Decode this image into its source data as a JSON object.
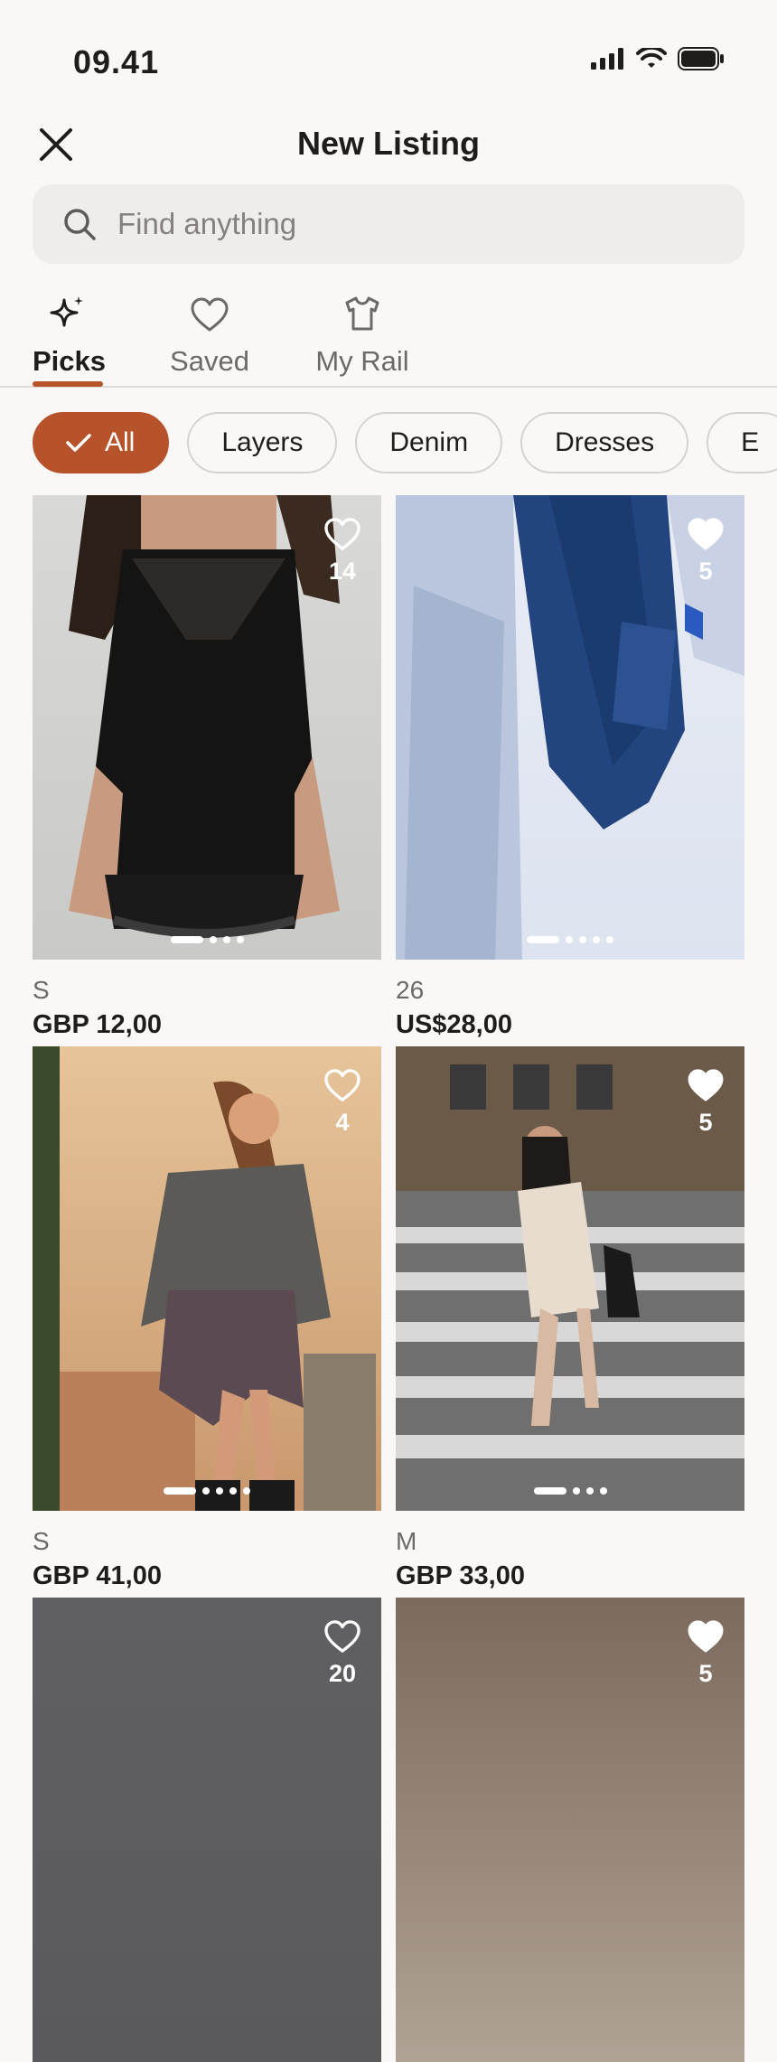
{
  "status": {
    "time": "09.41"
  },
  "header": {
    "title": "New Listing"
  },
  "search": {
    "placeholder": "Find anything"
  },
  "tabs": [
    {
      "label": "Picks",
      "icon": "sparkle-icon",
      "active": true
    },
    {
      "label": "Saved",
      "icon": "heart-icon",
      "active": false
    },
    {
      "label": "My Rail",
      "icon": "tshirt-icon",
      "active": false
    }
  ],
  "chips": [
    "All",
    "Layers",
    "Denim",
    "Dresses",
    "E"
  ],
  "listings": [
    {
      "size": "S",
      "price": "GBP 12,00",
      "likes": "14",
      "liked": false,
      "photos": 4,
      "photo_desc": "black lace slip top"
    },
    {
      "size": "26",
      "price": "US$28,00",
      "likes": "5",
      "liked": true,
      "photos": 5,
      "photo_desc": "denim jeans hanging"
    },
    {
      "size": "S",
      "price": "GBP 41,00",
      "likes": "4",
      "liked": false,
      "photos": 5,
      "photo_desc": "grey sweater with plaid shirt"
    },
    {
      "size": "M",
      "price": "GBP 33,00",
      "likes": "5",
      "liked": true,
      "photos": 4,
      "photo_desc": "cream sweater dress street"
    },
    {
      "size": "",
      "price": "",
      "likes": "20",
      "liked": false,
      "photos": 0,
      "photo_desc": ""
    },
    {
      "size": "",
      "price": "",
      "likes": "5",
      "liked": true,
      "photos": 0,
      "photo_desc": ""
    }
  ],
  "colors": {
    "accent": "#b6532b",
    "background": "#faf8f7",
    "search_bg": "#efedec"
  }
}
